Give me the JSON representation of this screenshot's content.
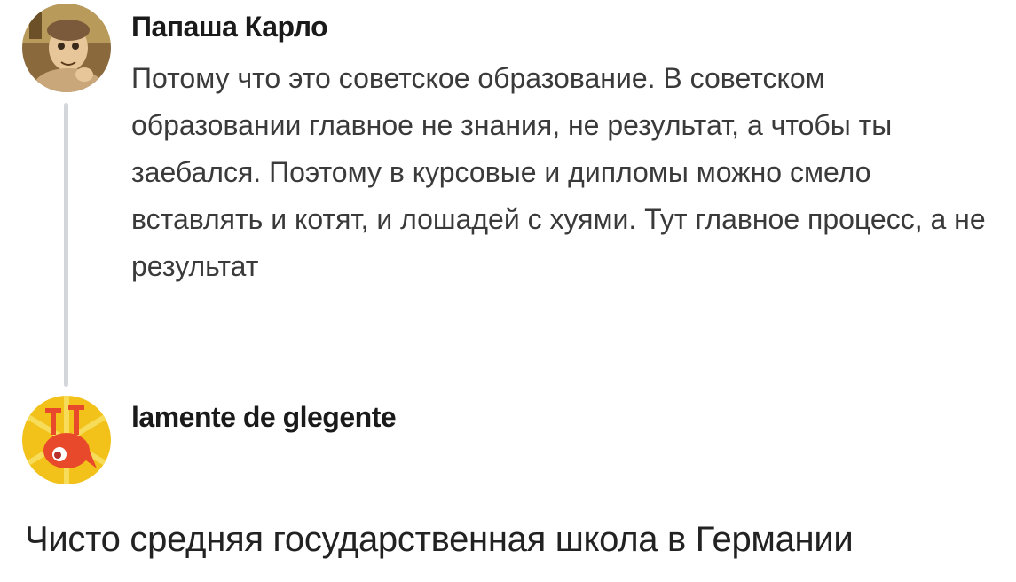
{
  "comments": [
    {
      "author": "Папаша Карло",
      "avatar_icon": "old-man-cartoon-avatar-icon",
      "text": "Потому что это советское образование. В советском образовании главное не знания, не результат, а чтобы ты заебался. Поэтому в курсовые и дипломы можно смело вставлять и котят, и лошадей с хуями. Тут главное процесс, а не результат"
    },
    {
      "author": "lamente de glegente",
      "avatar_icon": "orange-creature-avatar-icon",
      "text": "Чисто средняя государственная школа в Германии"
    }
  ],
  "colors": {
    "thread_line": "#d3d6da",
    "avatar2_bg": "#f2c21b"
  }
}
